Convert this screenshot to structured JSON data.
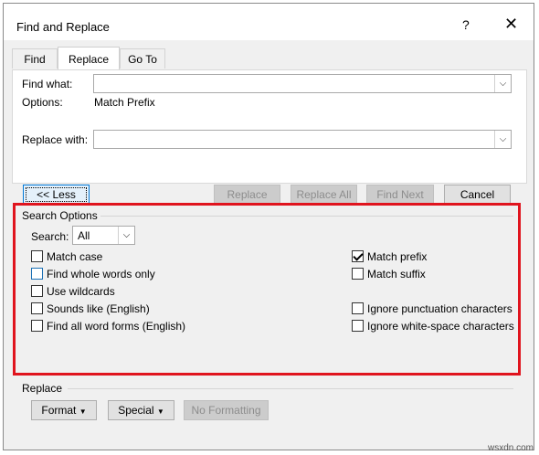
{
  "window": {
    "title": "Find and Replace",
    "help_label": "?",
    "close_label": "✕"
  },
  "tabs": [
    {
      "label": "Find",
      "active": false
    },
    {
      "label": "Replace",
      "active": true
    },
    {
      "label": "Go To",
      "active": false
    }
  ],
  "find": {
    "label": "Find what:",
    "value": "",
    "options_label": "Options:",
    "options_value": "Match Prefix"
  },
  "replace": {
    "label": "Replace with:",
    "value": ""
  },
  "buttons": {
    "less": "<< Less",
    "replace": "Replace",
    "replace_all": "Replace All",
    "find_next": "Find Next",
    "cancel": "Cancel"
  },
  "search_options": {
    "title": "Search Options",
    "search_label": "Search:",
    "search_value": "All",
    "left": [
      {
        "label": "Match case",
        "checked": false
      },
      {
        "label": "Find whole words only",
        "checked": false
      },
      {
        "label": "Use wildcards",
        "checked": false
      },
      {
        "label": "Sounds like (English)",
        "checked": false
      },
      {
        "label": "Find all word forms (English)",
        "checked": false
      }
    ],
    "right": [
      {
        "label": "Match prefix",
        "checked": true
      },
      {
        "label": "Match suffix",
        "checked": false
      },
      {
        "label": "Ignore punctuation characters",
        "checked": false
      },
      {
        "label": "Ignore white-space characters",
        "checked": false
      }
    ]
  },
  "replace_section": {
    "title": "Replace",
    "format": "Format",
    "special": "Special",
    "no_formatting": "No Formatting"
  },
  "watermark": "wsxdn.com",
  "highlight_color": "#e0141e"
}
